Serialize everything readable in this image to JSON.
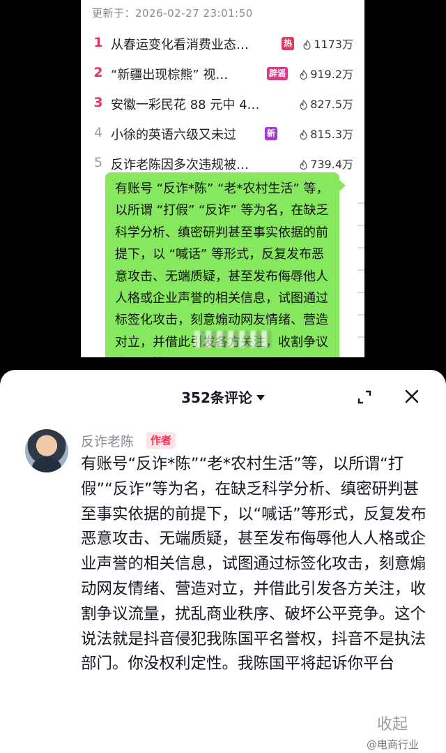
{
  "hot_list": {
    "updated": "更新于：2026-02-27 23:01:50",
    "items": [
      {
        "rank": "1",
        "title": "从春运变化看消费业态…",
        "tag": "热",
        "heat": "1173万"
      },
      {
        "rank": "2",
        "title": "“新疆出现棕熊” 视…",
        "tag": "辟谣",
        "heat": "919.2万"
      },
      {
        "rank": "3",
        "title": "安徽一彩民花 88 元中 4…",
        "tag": "",
        "heat": "827.5万"
      },
      {
        "rank": "4",
        "title": "小徐的英语六级又未过",
        "tag": "新",
        "heat": "815.3万"
      },
      {
        "rank": "5",
        "title": "反诈老陈因多次违规被…",
        "tag": "",
        "heat": "739.4万"
      }
    ],
    "bubble_text": "有账号 “反诈*陈” “老*农村生活” 等，以所谓 “打假” “反诈” 等为名，在缺乏科学分析、缜密研判甚至事实依据的前提下，以 “喊话” 等形式，反复发布恶意攻击、无端质疑，甚至发布侮辱他人人格或企业声誉的相关信息，试图通过标签化攻击，刻意煽动网友情绪、营造对立，并借此引发各方关注，收割争议流量，扰"
  },
  "comments_panel": {
    "title": "352条评论",
    "author": "反诈老陈",
    "author_badge": "作者",
    "comment": "有账号“反诈*陈”“老*农村生活”等，以所谓“打假”“反诈”等为名，在缺乏科学分析、缜密研判甚至事实依据的前提下，以“喊话”等形式，反复发布恶意攻击、无端质疑，甚至发布侮辱他人人格或企业声誉的相关信息，试图通过标签化攻击，刻意煽动网友情绪、营造对立，并借此引发各方关注，收割争议流量，扰乱商业秩序、破坏公平竞争。这个说法就是抖音侵犯我陈国平名誉权，抖音不是执法部门。你没权利定性。我陈国平将起诉你平台",
    "collapse_label": "收起"
  },
  "watermark": "@电商行业",
  "colors": {
    "hot_red": "#e8355d",
    "bubble_green": "#86e85e",
    "badge_pink": "#fe2c55"
  }
}
